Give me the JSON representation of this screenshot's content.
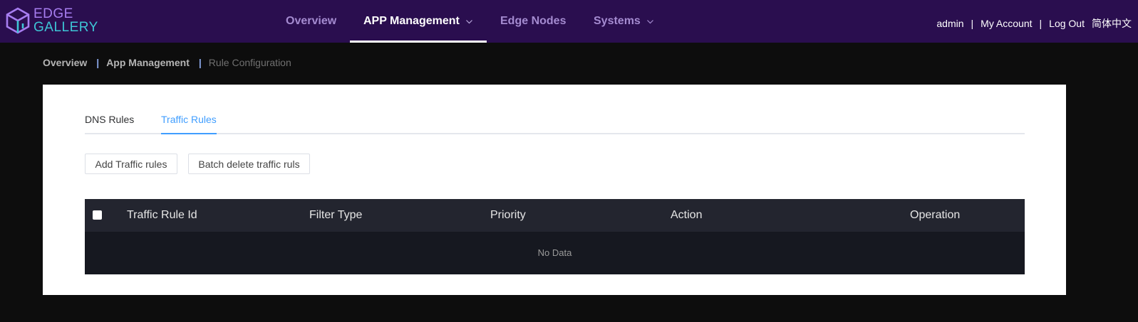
{
  "brand": {
    "line1": "EDGE",
    "line2": "GALLERY",
    "icon": "edgegallery-cube-icon",
    "colors": {
      "purple": "#a77df0",
      "cyan": "#3ec6d6",
      "header_bg": "#2a0e4f"
    }
  },
  "nav": {
    "items": [
      {
        "label": "Overview",
        "has_dropdown": false,
        "active": false
      },
      {
        "label": "APP Management",
        "has_dropdown": true,
        "active": true
      },
      {
        "label": "Edge Nodes",
        "has_dropdown": false,
        "active": false
      },
      {
        "label": "Systems",
        "has_dropdown": true,
        "active": false
      }
    ]
  },
  "user": {
    "username": "admin",
    "separator": "|",
    "my_account": "My Account",
    "logout": "Log Out",
    "language": "简体中文"
  },
  "breadcrumb": {
    "items": [
      "Overview",
      "App Management",
      "Rule Configuration"
    ],
    "separator": "|"
  },
  "tabs": [
    {
      "label": "DNS Rules",
      "active": false
    },
    {
      "label": "Traffic Rules",
      "active": true
    }
  ],
  "toolbar": {
    "add_label": "Add Traffic rules",
    "batch_delete_label": "Batch delete traffic ruls"
  },
  "table": {
    "columns": [
      "Traffic Rule Id",
      "Filter Type",
      "Priority",
      "Action",
      "Operation"
    ],
    "rows": [],
    "empty_text": "No Data",
    "select_all_checked": false
  },
  "colors": {
    "accent": "#409eff",
    "page_bg": "#0d0d0d",
    "table_header_bg": "#23252f",
    "table_body_bg": "#161820"
  }
}
